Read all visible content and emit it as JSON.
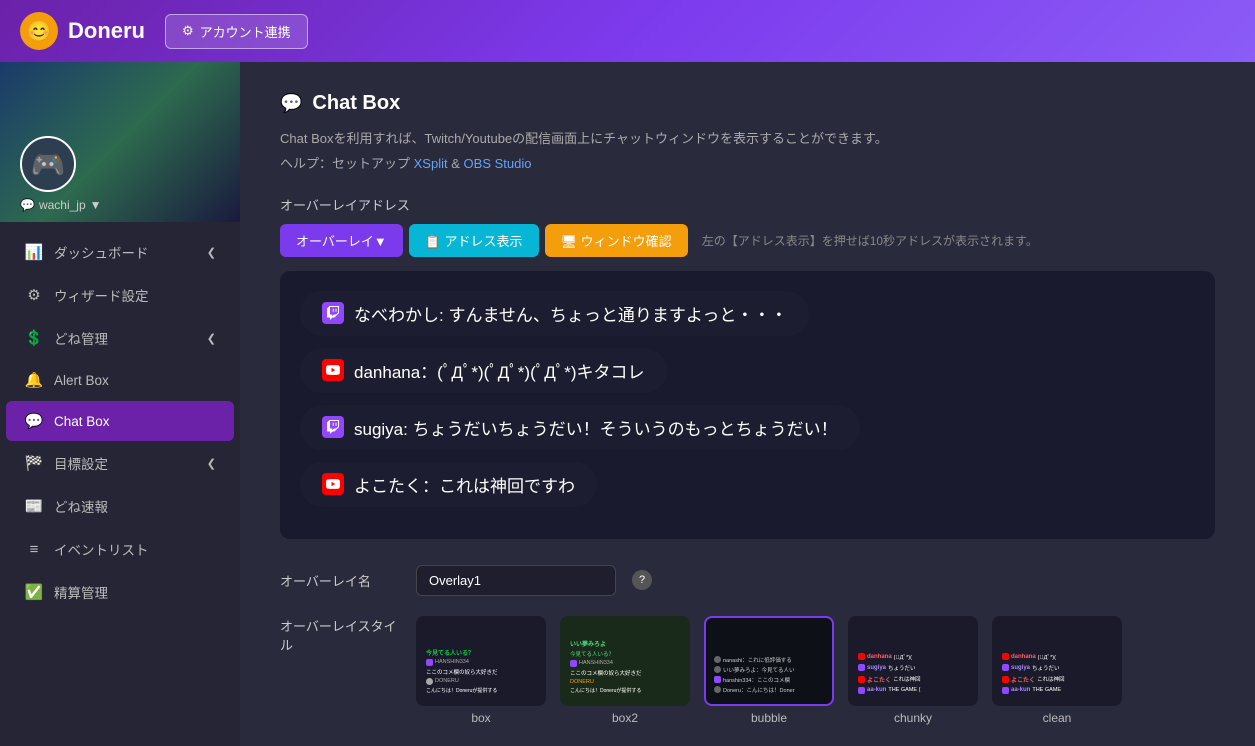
{
  "header": {
    "logo_icon": "😊",
    "logo_text": "Doneru",
    "account_btn": "アカウント連携",
    "gear_icon": "⚙"
  },
  "sidebar": {
    "user": {
      "username": "wachi_jp",
      "avatar": "🎮"
    },
    "items": [
      {
        "id": "dashboard",
        "icon": "📊",
        "label": "ダッシュボード",
        "has_chevron": true
      },
      {
        "id": "wizard",
        "icon": "⚙",
        "label": "ウィザード設定",
        "has_chevron": false
      },
      {
        "id": "done-mgmt",
        "icon": "💲",
        "label": "どね管理",
        "has_chevron": true
      },
      {
        "id": "alert-box",
        "icon": "🔔",
        "label": "Alert Box",
        "has_chevron": false
      },
      {
        "id": "chat-box",
        "icon": "💬",
        "label": "Chat Box",
        "has_chevron": false,
        "active": true
      },
      {
        "id": "goal",
        "icon": "🏁",
        "label": "目標設定",
        "has_chevron": true
      },
      {
        "id": "done-soku",
        "icon": "📰",
        "label": "どね速報",
        "has_chevron": false
      },
      {
        "id": "event-list",
        "icon": "≡",
        "label": "イベントリスト",
        "has_chevron": false
      },
      {
        "id": "accounting",
        "icon": "✅",
        "label": "精算管理",
        "has_chevron": false
      }
    ]
  },
  "page": {
    "title": "Chat Box",
    "title_icon": "💬",
    "desc_text": "Chat Boxを利用すれば、Twitch/Youtubeの配信画面上にチャットウィンドウを表示することができます。",
    "help_text": "ヘルプ：セットアップ",
    "xsplit_link": "XSplit",
    "amp_text": "&",
    "obs_link": "OBS Studio"
  },
  "overlay": {
    "section_label": "オーバーレイアドレス",
    "tab_overlay": "オーバーレイ▼",
    "tab_address": "📋 アドレス表示",
    "tab_window": "🖥 ウィンドウ確認",
    "tab_hint": "左の【アドレス表示】を押せば10秒アドレスが表示されます。"
  },
  "chat_messages": [
    {
      "platform": "twitch",
      "text": "なべわかし: すんません、ちょっと通りますよっと・・・"
    },
    {
      "platform": "youtube",
      "text": "danhana：(ﾟДﾟ*)(ﾟДﾟ*)(ﾟДﾟ*)キタコレ"
    },
    {
      "platform": "twitch",
      "text": "sugiya: ちょうだいちょうだい！そういうのもっとちょうだい！"
    },
    {
      "platform": "youtube",
      "text": "よこたく：これは神回ですわ"
    }
  ],
  "overlay_settings": {
    "name_label": "オーバーレイ名",
    "name_value": "Overlay1",
    "style_label": "オーバーレイスタイル"
  },
  "style_cards": [
    {
      "id": "box",
      "label": "box",
      "selected": false
    },
    {
      "id": "box2",
      "label": "box2",
      "selected": false
    },
    {
      "id": "bubble",
      "label": "bubble",
      "selected": true
    },
    {
      "id": "chunky",
      "label": "chunky",
      "selected": false
    },
    {
      "id": "clean",
      "label": "clean",
      "selected": false
    }
  ]
}
